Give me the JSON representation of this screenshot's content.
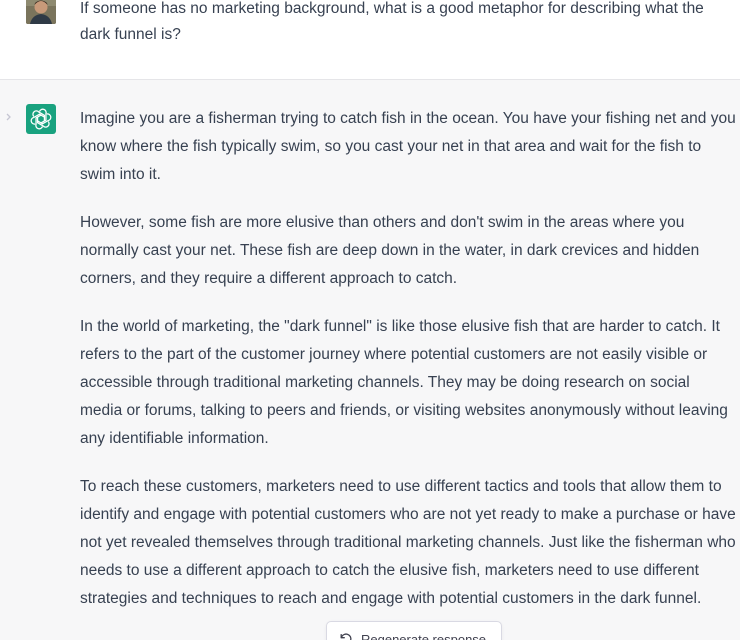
{
  "user_message": {
    "text": "If someone has no marketing background, what is a good metaphor for describing what the dark funnel is?"
  },
  "assistant_message": {
    "paragraphs": [
      "Imagine you are a fisherman trying to catch fish in the ocean. You have your fishing net and you know where the fish typically swim, so you cast your net in that area and wait for the fish to swim into it.",
      "However, some fish are more elusive than others and don't swim in the areas where you normally cast your net. These fish are deep down in the water, in dark crevices and hidden corners, and they require a different approach to catch.",
      "In the world of marketing, the \"dark funnel\" is like those elusive fish that are harder to catch. It refers to the part of the customer journey where potential customers are not easily visible or accessible through traditional marketing channels. They may be doing research on social media or forums, talking to peers and friends, or visiting websites anonymously without leaving any identifiable information.",
      "To reach these customers, marketers need to use different tactics and tools that allow them to identify and engage with potential customers who are not yet ready to make a purchase or have not yet revealed themselves through traditional marketing channels. Just like the fisherman who needs to use a different approach to catch the elusive fish, marketers need to use different strategies and techniques to reach and engage with potential customers in the dark funnel."
    ]
  },
  "regenerate_button": {
    "label": "Regenerate response"
  },
  "colors": {
    "assistant_avatar": "#19a27f",
    "assistant_bg": "#f7f7f8",
    "text": "#374151"
  },
  "icons": {
    "user_avatar": "user-photo",
    "assistant_avatar": "openai-logo-icon",
    "regenerate": "regenerate-icon",
    "expand": "chevron-right-icon"
  }
}
